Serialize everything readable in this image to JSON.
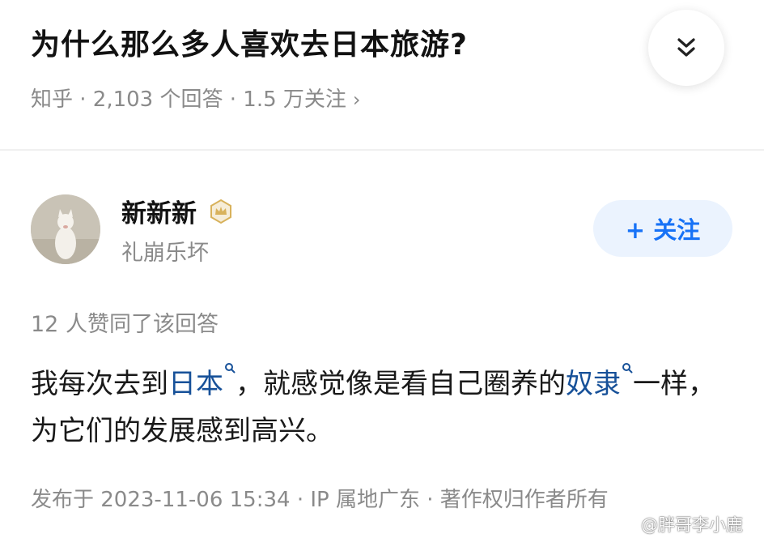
{
  "question": {
    "title": "为什么那么多人喜欢去日本旅游?",
    "meta": "知乎 · 2,103 个回答 · 1.5 万关注",
    "meta_chevron": "›"
  },
  "collapse_icon": "double-chevron-down-icon",
  "author": {
    "name": "新新新",
    "bio": "礼崩乐坏",
    "follow_label": "+ 关注"
  },
  "answer": {
    "agree_text": "12 人赞同了该回答",
    "content_part1": "我每次去到",
    "link1": "日本",
    "content_part2": "，就感觉像是看自己圈养的",
    "link2": "奴隶",
    "content_part3": "一样，为它们的发展感到高兴。",
    "footer": "发布于 2023-11-06 15:34 · IP 属地广东 · 著作权归作者所有"
  },
  "watermark": "@胖哥李小鹿",
  "colors": {
    "link": "#175199",
    "accent": "#1772f6",
    "muted": "#8a8a8a",
    "badge": "#d8b25c"
  }
}
